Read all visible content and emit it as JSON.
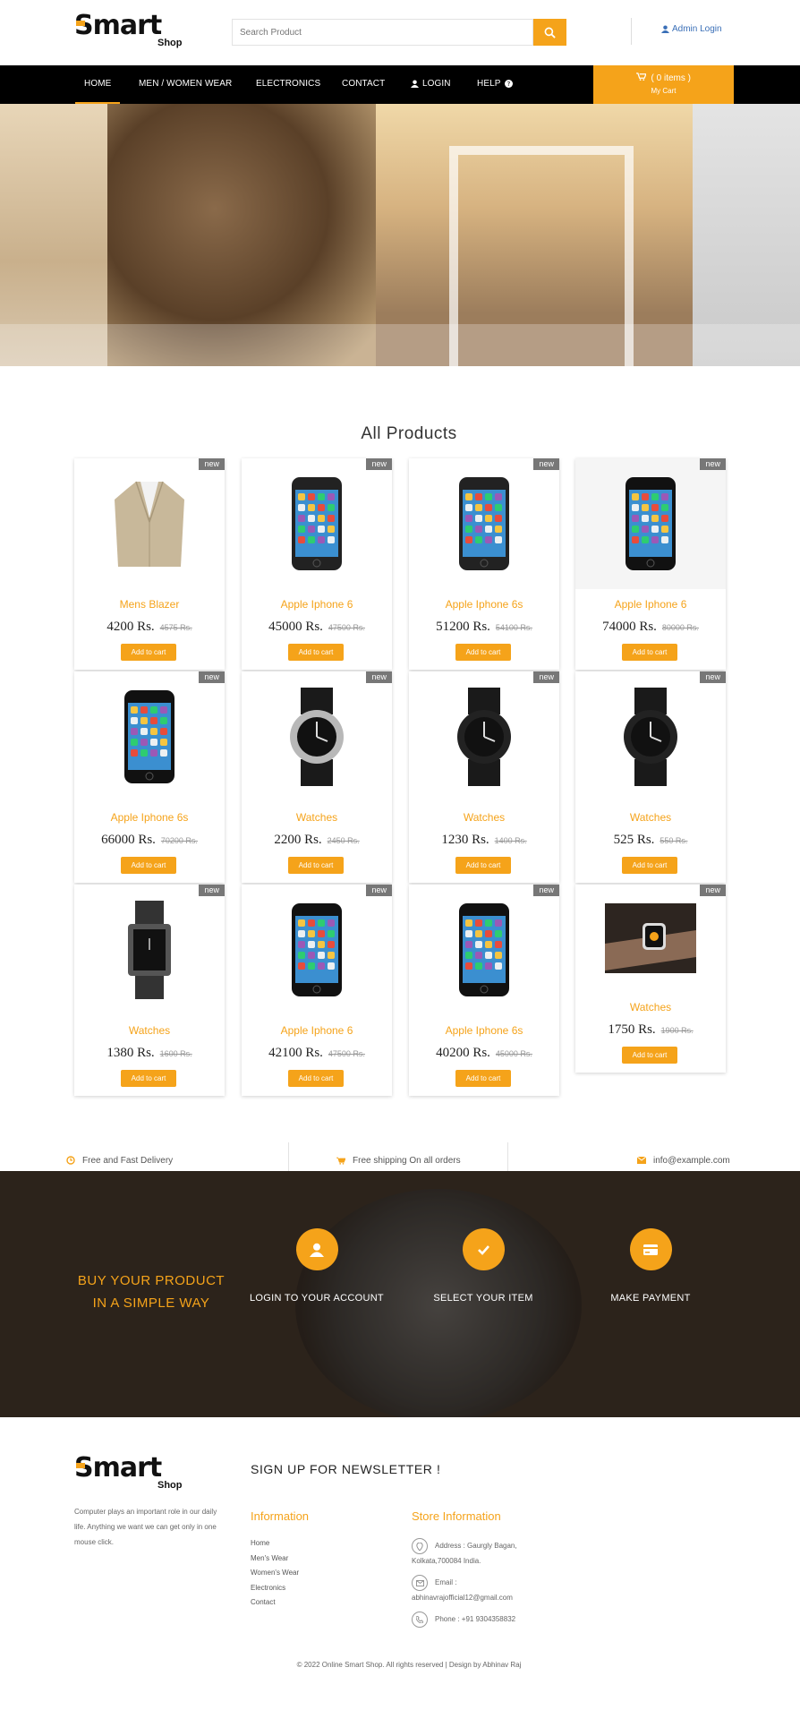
{
  "brand": {
    "logo_main": "mart",
    "logo_s": "S",
    "logo_sub": "Shop"
  },
  "header": {
    "search_placeholder": "Search Product",
    "admin_label": "Admin Login"
  },
  "nav": {
    "items": [
      "HOME",
      "MEN / WOMEN WEAR",
      "ELECTRONICS",
      "CONTACT",
      "LOGIN",
      "HELP"
    ],
    "active": "HOME"
  },
  "cart": {
    "count_label": "( 0 items )",
    "sub_label": "My Cart"
  },
  "hero": {
    "slide_dots": 3
  },
  "products_section": {
    "title": "All Products"
  },
  "products": [
    {
      "badge": "new",
      "name": "Mens Blazer",
      "price": "4200 Rs.",
      "old_price": "4575 Rs.",
      "button": "Add to cart",
      "image": "blazer"
    },
    {
      "badge": "new",
      "name": "Apple Iphone 6",
      "price": "45000 Rs.",
      "old_price": "47500 Rs.",
      "button": "Add to cart",
      "image": "phone-silver"
    },
    {
      "badge": "new",
      "name": "Apple Iphone 6s",
      "price": "51200 Rs.",
      "old_price": "54100 Rs.",
      "button": "Add to cart",
      "image": "phone-silver"
    },
    {
      "badge": "new",
      "name": "Apple Iphone 6",
      "price": "74000 Rs.",
      "old_price": "80000 Rs.",
      "button": "Add to cart",
      "image": "phone-dark"
    },
    {
      "badge": "new",
      "name": "Apple Iphone 6s",
      "price": "66000 Rs.",
      "old_price": "70200 Rs.",
      "button": "Add to cart",
      "image": "phone-dark"
    },
    {
      "badge": "new",
      "name": "Watches",
      "price": "2200 Rs.",
      "old_price": "2450 Rs.",
      "button": "Add to cart",
      "image": "watch-silver"
    },
    {
      "badge": "new",
      "name": "Watches",
      "price": "1230 Rs.",
      "old_price": "1400 Rs.",
      "button": "Add to cart",
      "image": "watch-black"
    },
    {
      "badge": "new",
      "name": "Watches",
      "price": "525 Rs.",
      "old_price": "550 Rs.",
      "button": "Add to cart",
      "image": "watch-black"
    },
    {
      "badge": "new",
      "name": "Watches",
      "price": "1380 Rs.",
      "old_price": "1600 Rs.",
      "button": "Add to cart",
      "image": "watch-square"
    },
    {
      "badge": "new",
      "name": "Apple Iphone 6",
      "price": "42100 Rs.",
      "old_price": "47500 Rs.",
      "button": "Add to cart",
      "image": "phone-dark"
    },
    {
      "badge": "new",
      "name": "Apple Iphone 6s",
      "price": "40200 Rs.",
      "old_price": "45000 Rs.",
      "button": "Add to cart",
      "image": "phone-dark"
    },
    {
      "badge": "new",
      "name": "Watches",
      "price": "1750 Rs.",
      "old_price": "1900 Rs.",
      "button": "Add to cart",
      "image": "smartwatch"
    }
  ],
  "info_bar": {
    "delivery": "Free and Fast Delivery",
    "shipping": "Free shipping On all orders",
    "email": "info@example.com"
  },
  "band": {
    "slogan_line1": "BUY YOUR PRODUCT",
    "slogan_line2": "IN A SIMPLE WAY",
    "steps": [
      "LOGIN TO YOUR ACCOUNT",
      "SELECT YOUR ITEM",
      "MAKE PAYMENT"
    ]
  },
  "footer": {
    "about": "Computer plays an important role in our daily life. Anything we want we can get only in one mouse click.",
    "newsletter_title": "SIGN UP FOR NEWSLETTER !",
    "info_title": "Information",
    "links": [
      "Home",
      "Men's Wear",
      "Women's Wear",
      "Electronics",
      "Contact"
    ],
    "store_title": "Store Information",
    "address": "Address : Gaurgly Bagan, Kolkata,700084 India.",
    "email": "Email : abhinavrajofficial12@gmail.com",
    "phone": "Phone : +91 9304358832",
    "copyright": "© 2022 Online Smart Shop. All rights reserved | Design by Abhinav Raj"
  },
  "colors": {
    "accent": "#f5a31a",
    "nav_bg": "#000000",
    "badge": "#777777"
  }
}
